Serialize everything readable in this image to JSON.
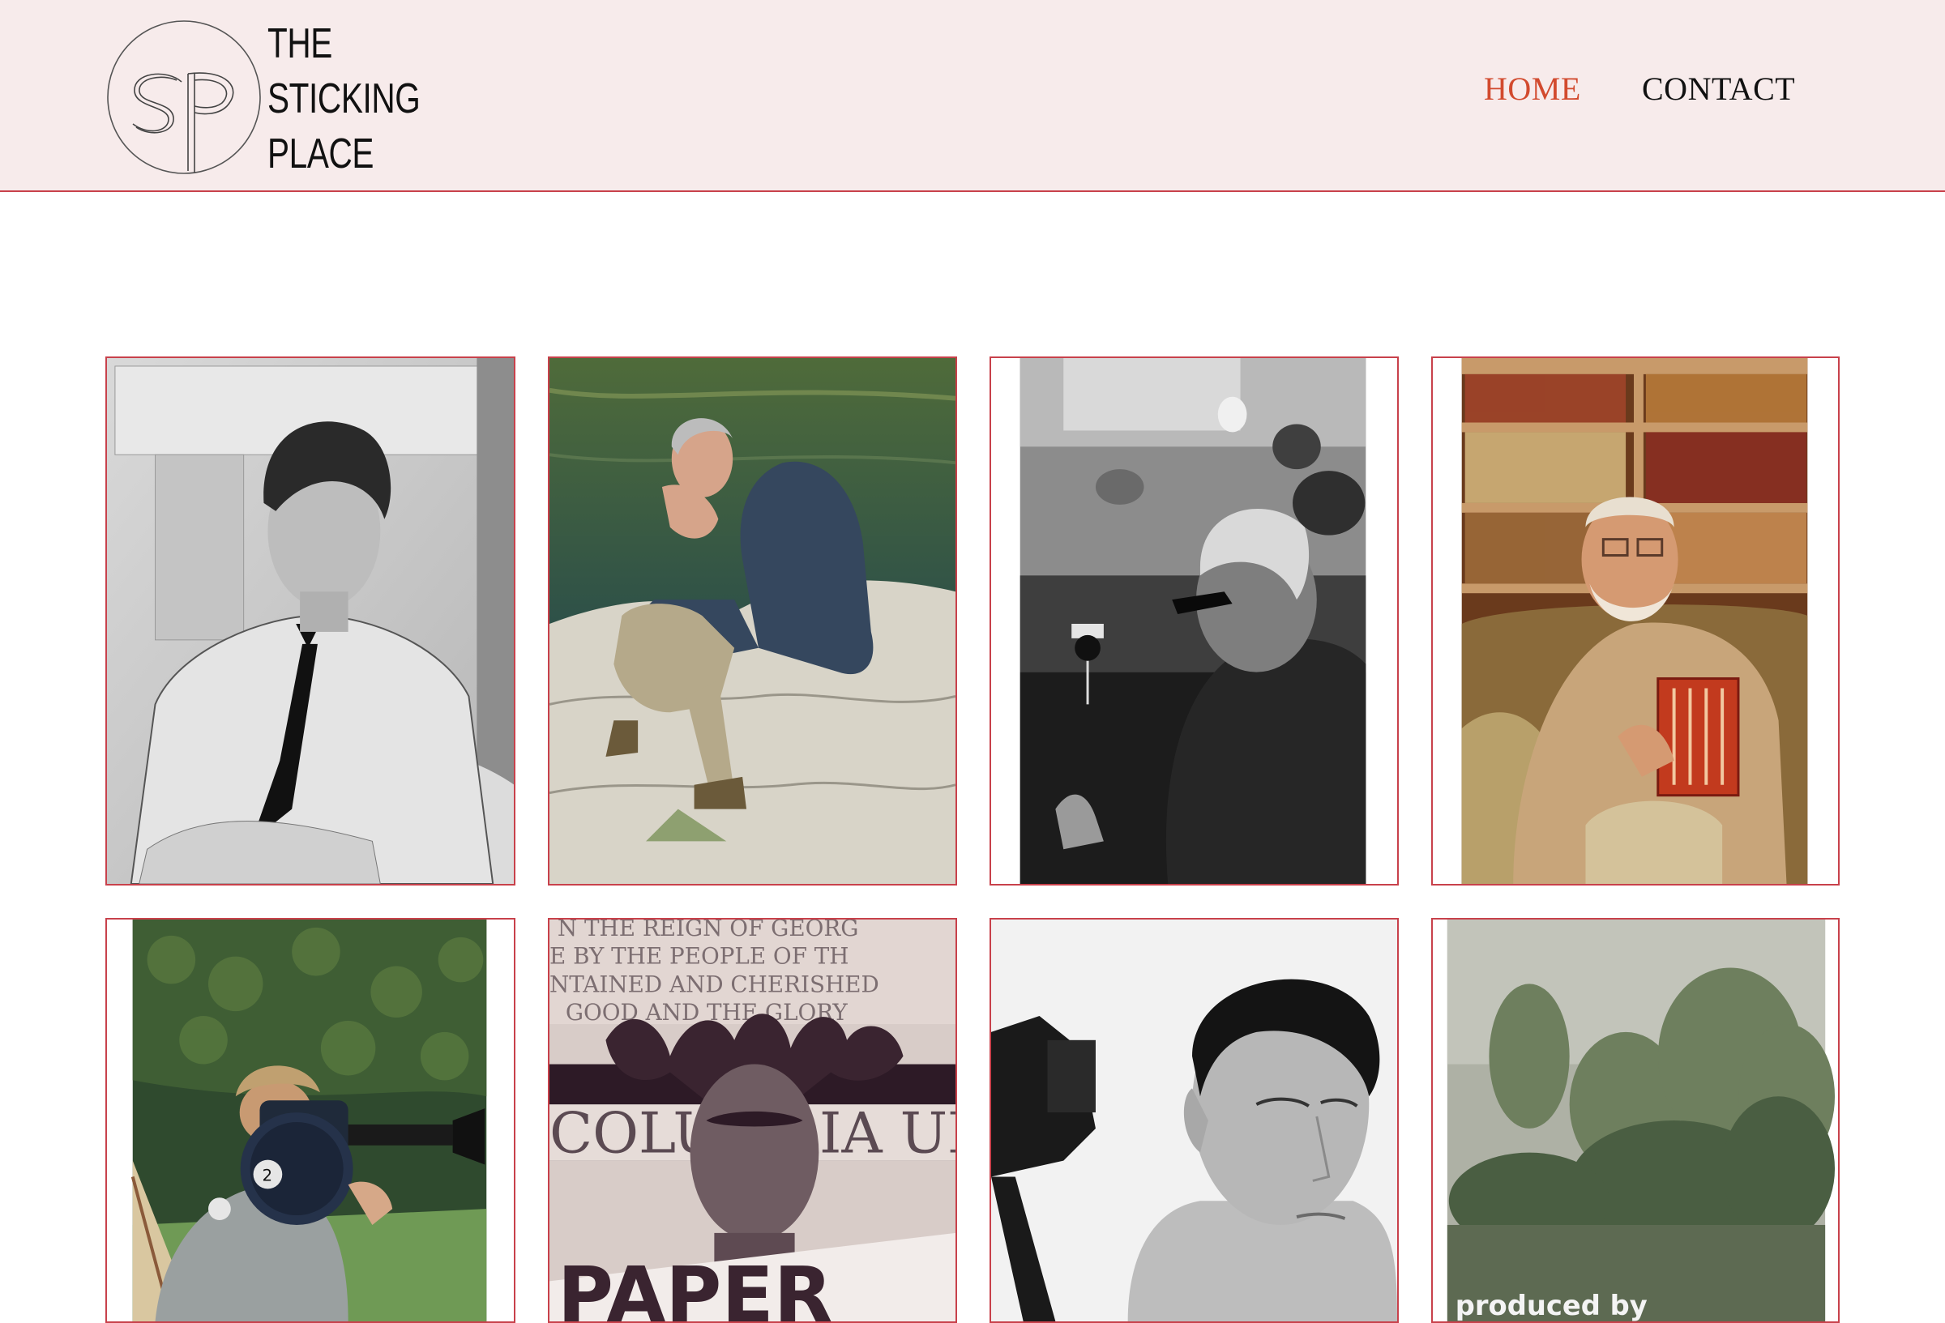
{
  "brand": {
    "line1": "THE",
    "line2": "STICKING",
    "line3": "PLACE",
    "monogram": "SP"
  },
  "nav": {
    "home": "HOME",
    "contact": "CONTACT",
    "active_color": "#d24a2e",
    "color": "#111111"
  },
  "colors": {
    "accent": "#c8414b",
    "header_bg": "#f7ebeb"
  },
  "gallery": {
    "items": [
      {
        "id": "portrait-man-necktie",
        "style": "black-and-white"
      },
      {
        "id": "man-sitting-on-rocks-by-water",
        "style": "color"
      },
      {
        "id": "man-with-sunglasses-at-table",
        "style": "black-and-white"
      },
      {
        "id": "bearded-man-with-book-in-library",
        "style": "color"
      },
      {
        "id": "person-with-film-camera",
        "style": "color"
      },
      {
        "id": "statue-columbia-university",
        "style": "duotone"
      },
      {
        "id": "young-man-beside-camera",
        "style": "black-and-white"
      },
      {
        "id": "misty-trees-poster",
        "style": "color"
      }
    ],
    "statue_text": {
      "line1": "N THE REIGN OF GEORG",
      "line2": "E BY THE PEOPLE OF TH",
      "line3": "NTAINED AND CHERISHED",
      "line4": "GOOD AND THE GLORY",
      "line5": "COLUMBIA UN",
      "sign": "PAPER"
    },
    "poster_text": "produced by"
  }
}
